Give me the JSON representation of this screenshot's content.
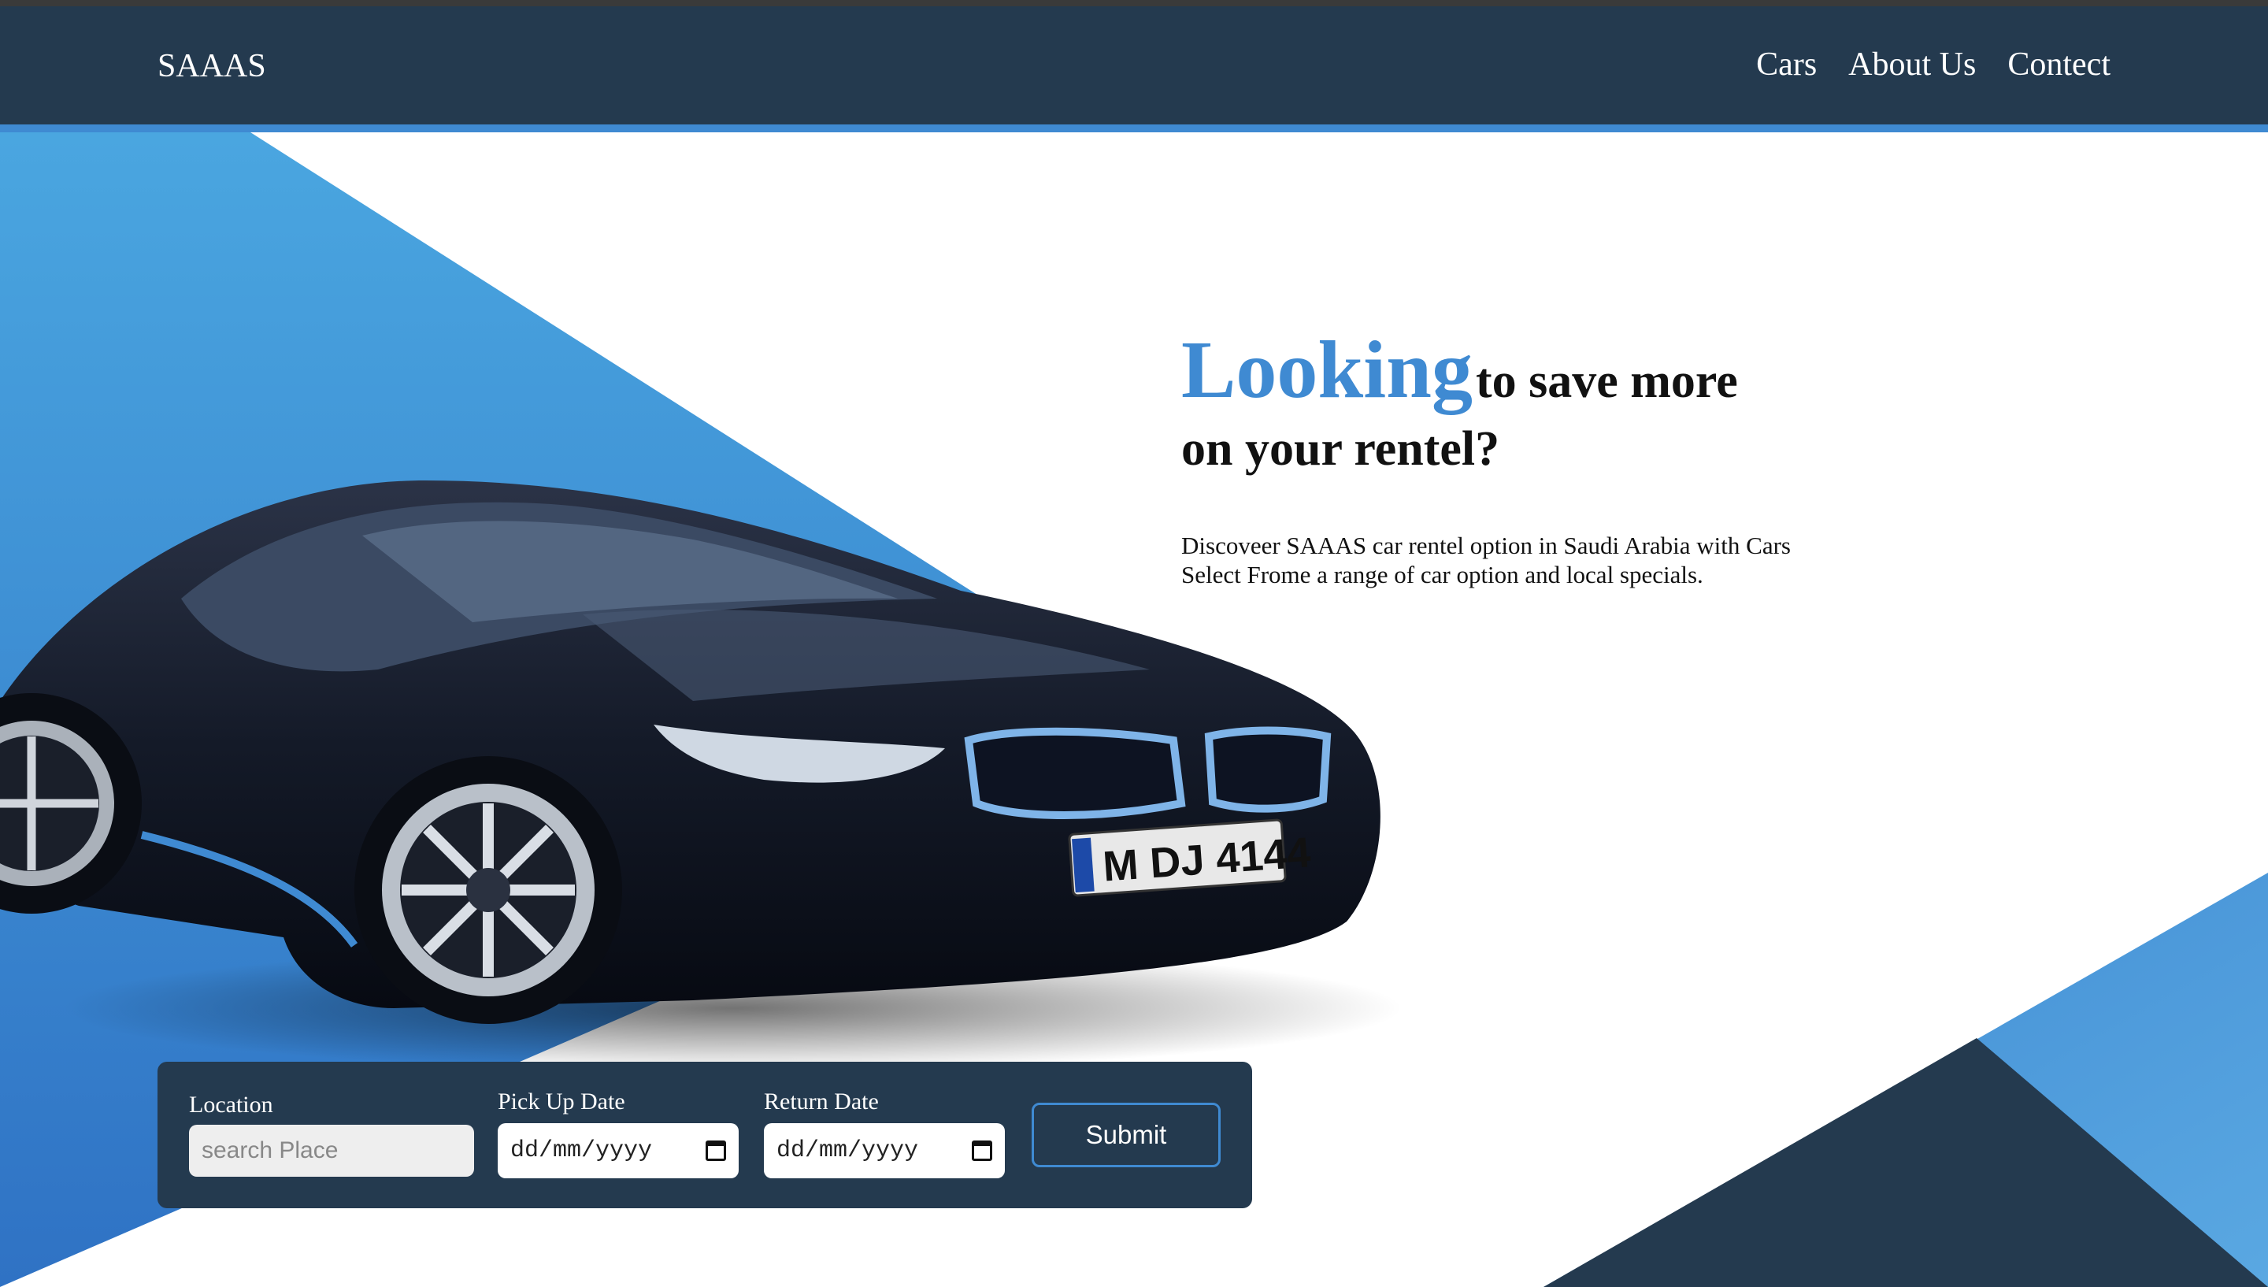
{
  "brand": "SAAAS",
  "nav": {
    "items": [
      {
        "label": "Cars"
      },
      {
        "label": "About Us"
      },
      {
        "label": "Contect"
      }
    ]
  },
  "hero": {
    "headline_accent": "Looking",
    "headline_rest": "to save more",
    "headline_line2": "on your rentel?",
    "description": "Discoveer SAAAS car rentel option in Saudi Arabia with Cars Select Frome a range of car option and local specials.",
    "car_plate": "M DJ 4144"
  },
  "search": {
    "location_label": "Location",
    "location_placeholder": "search Place",
    "pickup_label": "Pick Up Date",
    "pickup_value": "dd/mm/yyyy",
    "return_label": "Return Date",
    "return_value": "dd/mm/yyyy",
    "submit_label": "Submit"
  },
  "colors": {
    "navbar": "#243a4f",
    "accent": "#3f8ad2",
    "background": "#ffffff"
  },
  "icons": {
    "date_picker": "calendar-icon"
  }
}
